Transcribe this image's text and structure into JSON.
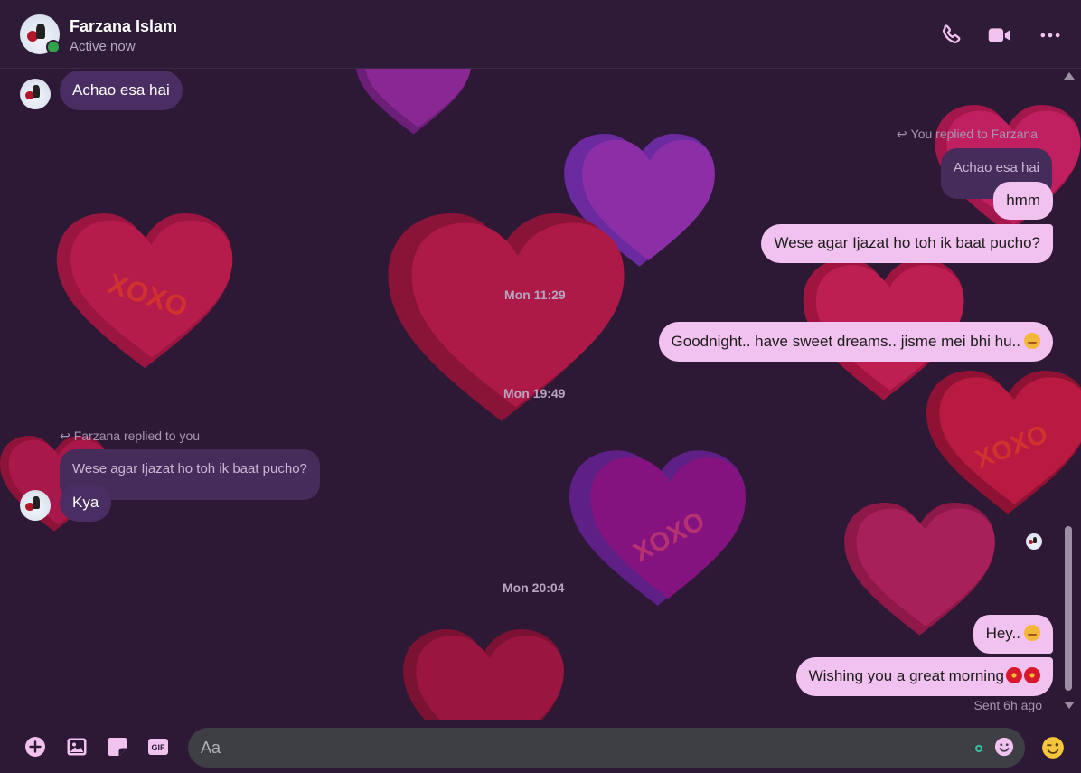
{
  "contact": {
    "name": "Farzana Islam",
    "status": "Active now"
  },
  "header_icons": [
    "phone-icon",
    "video-camera-icon",
    "more-options-icon"
  ],
  "messages": {
    "m1": "Achao esa hai",
    "reply_note_you": "You replied to Farzana",
    "quote_you": "Achao esa hai",
    "m2": "hmm",
    "m3": "Wese agar Ijazat ho toh ik baat pucho?",
    "time1": "Mon 11:29",
    "m4": "Goodnight.. have sweet dreams.. jisme mei bhi hu..",
    "time2": "Mon 19:49",
    "reply_note_her": "Farzana replied to you",
    "quote_her": "Wese agar Ijazat ho toh ik baat pucho?",
    "m5": "Kya",
    "time3": "Mon 20:04",
    "m6": "Hey..",
    "m7": "Wishing you a great morning",
    "sent_status": "Sent 6h ago"
  },
  "decor": {
    "heart_text": "XOXO"
  },
  "composer": {
    "placeholder": "Aa"
  },
  "colors": {
    "background": "#2d1936",
    "incoming_bubble": "#4a2e63",
    "outgoing_bubble": "#f1c1ef",
    "accent": "#f1c1ef",
    "online": "#31a24c"
  }
}
